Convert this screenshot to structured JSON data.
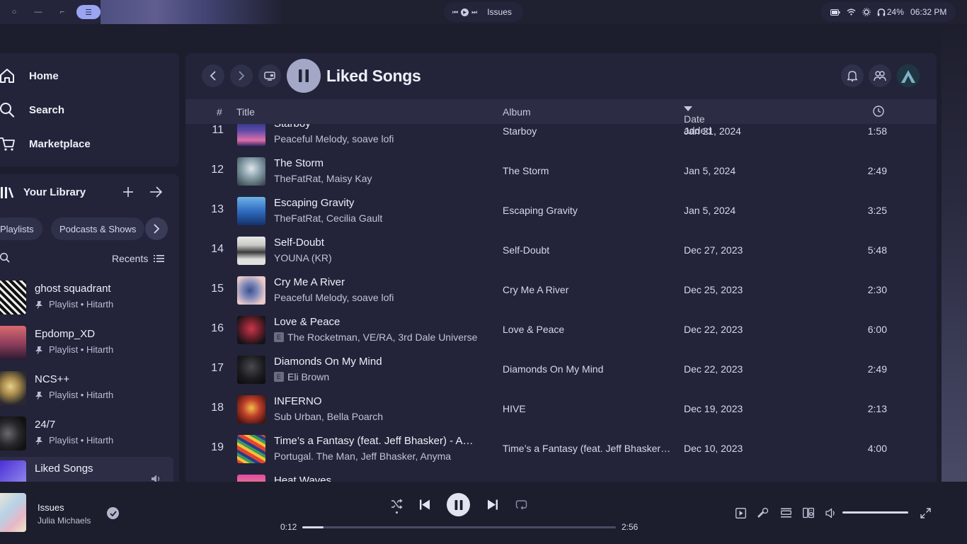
{
  "topbar": {
    "workspaces": [
      "○",
      "—",
      "⌐",
      "☰"
    ],
    "media_title": "Issues",
    "battery_percent": "24%",
    "clock": "06:32 PM"
  },
  "nav": {
    "home": "Home",
    "search": "Search",
    "marketplace": "Marketplace"
  },
  "library": {
    "title": "Your Library",
    "chips": [
      "Playlists",
      "Podcasts & Shows"
    ],
    "sort_label": "Recents",
    "items": [
      {
        "name": "ghost squadrant",
        "sub": "Playlist • Hitarth"
      },
      {
        "name": "Epdomp_XD",
        "sub": "Playlist • Hitarth"
      },
      {
        "name": "NCS++",
        "sub": "Playlist • Hitarth"
      },
      {
        "name": "24/7",
        "sub": "Playlist • Hitarth"
      },
      {
        "name": "Liked Songs",
        "sub": ""
      }
    ]
  },
  "main": {
    "title": "Liked Songs",
    "columns": {
      "num": "#",
      "title": "Title",
      "album": "Album",
      "date": "Date added"
    },
    "rows": [
      {
        "num": "11",
        "title": "Starboy",
        "artists": "Peaceful Melody, soave lofi",
        "explicit": false,
        "album": "Starboy",
        "date": "Jan 21, 2024",
        "duration": "1:58"
      },
      {
        "num": "12",
        "title": "The Storm",
        "artists": "TheFatRat, Maisy Kay",
        "explicit": false,
        "album": "The Storm",
        "date": "Jan 5, 2024",
        "duration": "2:49"
      },
      {
        "num": "13",
        "title": "Escaping Gravity",
        "artists": "TheFatRat, Cecilia Gault",
        "explicit": false,
        "album": "Escaping Gravity",
        "date": "Jan 5, 2024",
        "duration": "3:25"
      },
      {
        "num": "14",
        "title": "Self-Doubt",
        "artists": "YOUNA (KR)",
        "explicit": false,
        "album": "Self-Doubt",
        "date": "Dec 27, 2023",
        "duration": "5:48"
      },
      {
        "num": "15",
        "title": "Cry Me A River",
        "artists": "Peaceful Melody, soave lofi",
        "explicit": false,
        "album": "Cry Me A River",
        "date": "Dec 25, 2023",
        "duration": "2:30"
      },
      {
        "num": "16",
        "title": "Love & Peace",
        "artists": "The Rocketman, VE/RA, 3rd Dale Universe",
        "explicit": true,
        "album": "Love & Peace",
        "date": "Dec 22, 2023",
        "duration": "6:00"
      },
      {
        "num": "17",
        "title": "Diamonds On My Mind",
        "artists": "Eli Brown",
        "explicit": true,
        "album": "Diamonds On My Mind",
        "date": "Dec 22, 2023",
        "duration": "2:49"
      },
      {
        "num": "18",
        "title": "INFERNO",
        "artists": "Sub Urban, Bella Poarch",
        "explicit": false,
        "album": "HIVE",
        "date": "Dec 19, 2023",
        "duration": "2:13"
      },
      {
        "num": "19",
        "title": "Time’s a Fantasy (feat. Jeff Bhasker) - A…",
        "artists": "Portugal. The Man, Jeff Bhasker, Anyma",
        "explicit": false,
        "album": "Time’s a Fantasy (feat. Jeff Bhasker) …",
        "date": "Dec 10, 2023",
        "duration": "4:00"
      },
      {
        "num": "",
        "title": "Heat Waves",
        "artists": "",
        "explicit": false,
        "album": "",
        "date": "",
        "duration": ""
      }
    ]
  },
  "player": {
    "title": "Issues",
    "artist": "Julia Michaels",
    "elapsed": "0:12",
    "total": "2:56",
    "progress_fraction": 0.068,
    "volume_fraction": 1.0
  },
  "colors": {
    "background": "#1d1e2d",
    "panel": "#23243a",
    "accent": "#9aa6f2"
  }
}
